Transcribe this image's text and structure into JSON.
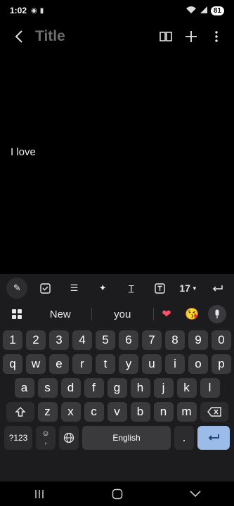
{
  "status": {
    "time": "1:02",
    "battery": "81"
  },
  "app_bar": {
    "title": "Title"
  },
  "note": {
    "text": "I love"
  },
  "toolbar": {
    "font_size": "17"
  },
  "suggestions": [
    "New",
    "you"
  ],
  "keys": {
    "numbers": [
      "1",
      "2",
      "3",
      "4",
      "5",
      "6",
      "7",
      "8",
      "9",
      "0"
    ],
    "row1": [
      "q",
      "w",
      "e",
      "r",
      "t",
      "y",
      "u",
      "i",
      "o",
      "p"
    ],
    "row2": [
      "a",
      "s",
      "d",
      "f",
      "g",
      "h",
      "j",
      "k",
      "l"
    ],
    "row3": [
      "z",
      "x",
      "c",
      "v",
      "b",
      "n",
      "m"
    ],
    "symbols": "?123",
    "comma": ",",
    "space": "English",
    "period": "."
  }
}
